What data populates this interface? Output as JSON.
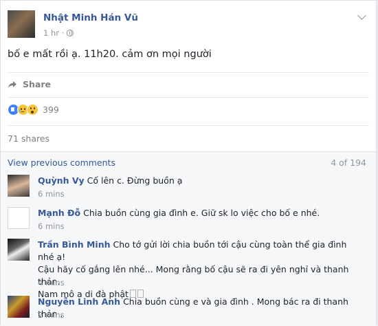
{
  "post": {
    "author": "Nhật Minh Hán Vũ",
    "time": "1 hr ·",
    "text": "bố e mất rồi ạ. 11h20. cảm ơn mọi người",
    "share_label": "Share",
    "reaction_icons": [
      "like-icon",
      "sad-icon",
      "wow-icon"
    ],
    "reaction_count": "399",
    "shares": "71 shares"
  },
  "comments_section": {
    "view_previous": "View previous comments",
    "count": "4 of 194",
    "comments": [
      {
        "name": "Quỳnh Vy",
        "text": "Cố lên c. Đừng buồn ạ",
        "time": "6 mins"
      },
      {
        "name": "Mạnh Đỗ",
        "text": "Chia buồn cùng gia đình e. Giữ sk lo việc cho bố e nhé.",
        "time": "6 mins"
      },
      {
        "name": "Trần Bình Minh",
        "line1": "Cho tớ gửi lời chia buồn tới cậu cùng toàn thể gia đình nhé ạ!",
        "line2": "Cậu hãy cố gắng lên nhé... Mong rằng bố cậu sẽ ra đi yên nghỉ và thanh thản.",
        "line3": "Nam mô a di đà phật",
        "time": "4 mins"
      },
      {
        "name": "Nguyễn Linh Anh",
        "text": "Chia buồn cùng e và gia đình . Mong bác ra đi thanh thản .",
        "time": "2 mins"
      }
    ]
  },
  "colors": {
    "link_blue": "#365899",
    "meta_gray": "#90949c",
    "like_blue": "#4080ff",
    "emoji_yellow": "#f7c43a"
  }
}
